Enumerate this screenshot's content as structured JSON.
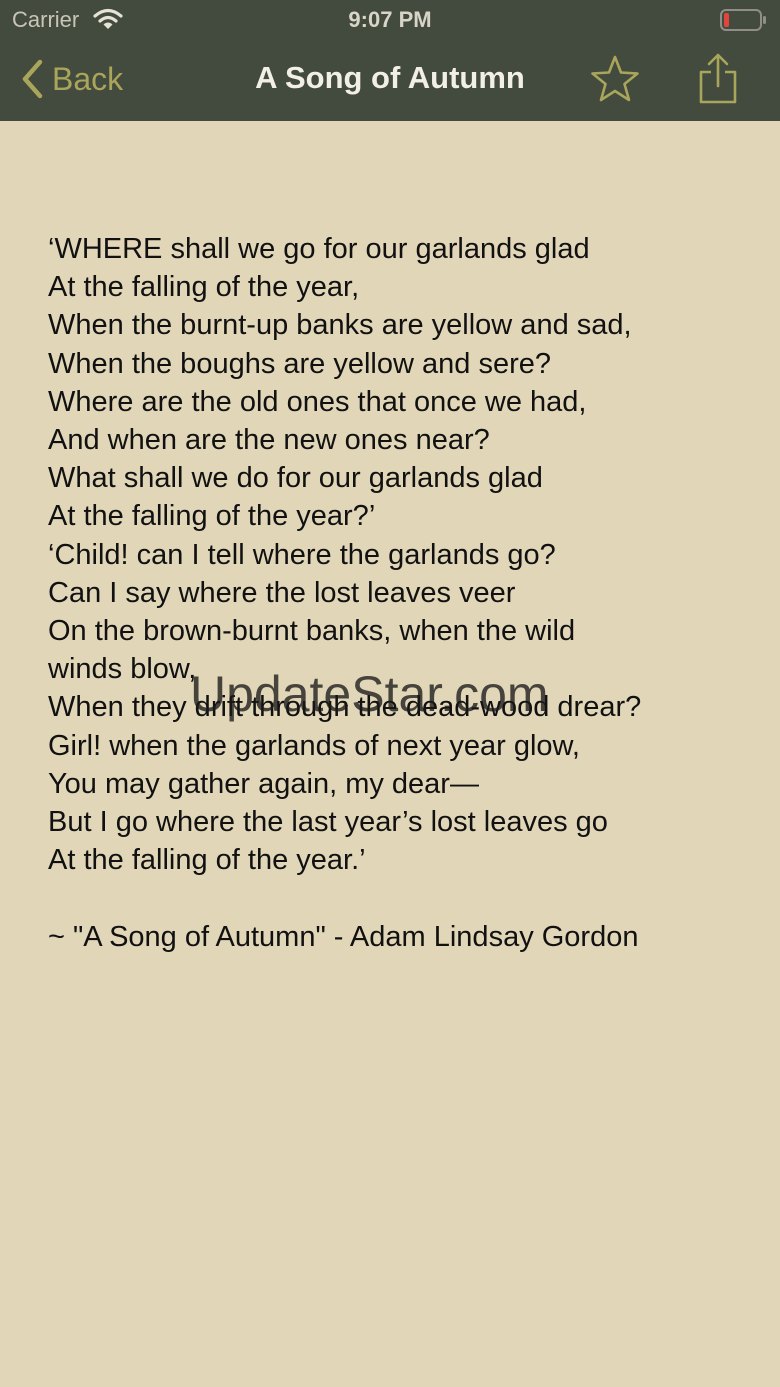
{
  "status_bar": {
    "carrier": "Carrier",
    "time": "9:07 PM",
    "icons": [
      "wifi-icon",
      "battery-icon"
    ],
    "battery_color": "#e0463c"
  },
  "nav": {
    "back_label": "Back",
    "title": "A Song of Autumn",
    "icons": [
      "chevron-left-icon",
      "star-outline-icon",
      "share-icon"
    ],
    "accent_color": "#a9a55b",
    "bar_color": "#434b3f"
  },
  "poem": {
    "lines": [
      "‘WHERE shall we go for our garlands glad",
      "At the falling of the year,",
      "When the burnt-up banks are yellow and sad,",
      "When the boughs are yellow and sere?",
      "Where are the old ones that once we had,",
      "And when are the new ones near?",
      "What shall we do for our garlands glad",
      "At the falling of the year?’",
      "‘Child! can I tell where the garlands go?",
      "Can I say where the lost leaves veer",
      "On the brown-burnt banks, when the wild",
      "winds blow,",
      "When they drift through the dead-wood drear?",
      "Girl! when the garlands of next year glow,",
      "You may gather again, my dear—",
      "But I go where the last year’s lost leaves go",
      "At the falling of the year.’"
    ],
    "attribution": "~ \"A Song of Autumn\" - Adam Lindsay Gordon",
    "background_color": "#e1d6b8"
  },
  "watermark": {
    "text": "UpdateStar.com"
  }
}
